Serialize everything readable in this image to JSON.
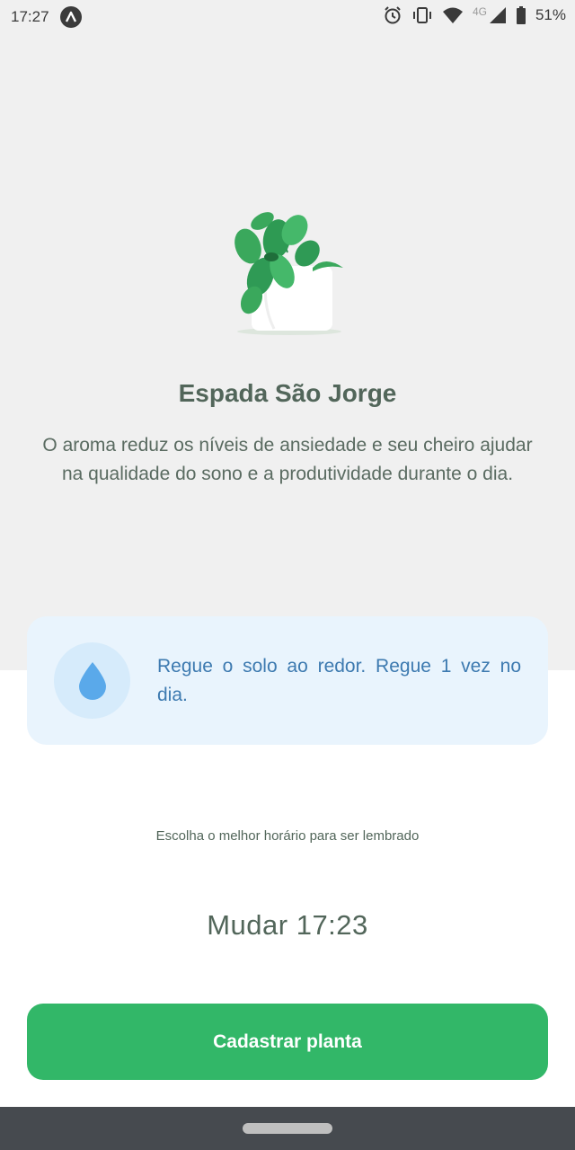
{
  "status_bar": {
    "time": "17:27",
    "network": "4G",
    "battery": "51%",
    "icons": [
      "app-notification-icon",
      "alarm-icon",
      "vibrate-icon",
      "wifi-icon",
      "signal-icon",
      "battery-icon"
    ]
  },
  "plant": {
    "name": "Espada São Jorge",
    "about": "O aroma reduz os níveis de ansiedade e seu cheiro ajudar na qualidade do sono e a produtividade durante o dia."
  },
  "water_tip": {
    "icon": "water-drop-icon",
    "text": "Regue o solo ao redor. Regue 1 vez no dia."
  },
  "reminder": {
    "label": "Escolha o melhor horário para ser lembrado",
    "time_button": "Mudar 17:23"
  },
  "actions": {
    "submit_label": "Cadastrar planta"
  },
  "colors": {
    "accent_green": "#32b768",
    "heading": "#52665a",
    "tip_blue": "#3d7ab0",
    "tip_background": "#e9f4fd",
    "top_background": "#f0f0f0"
  }
}
